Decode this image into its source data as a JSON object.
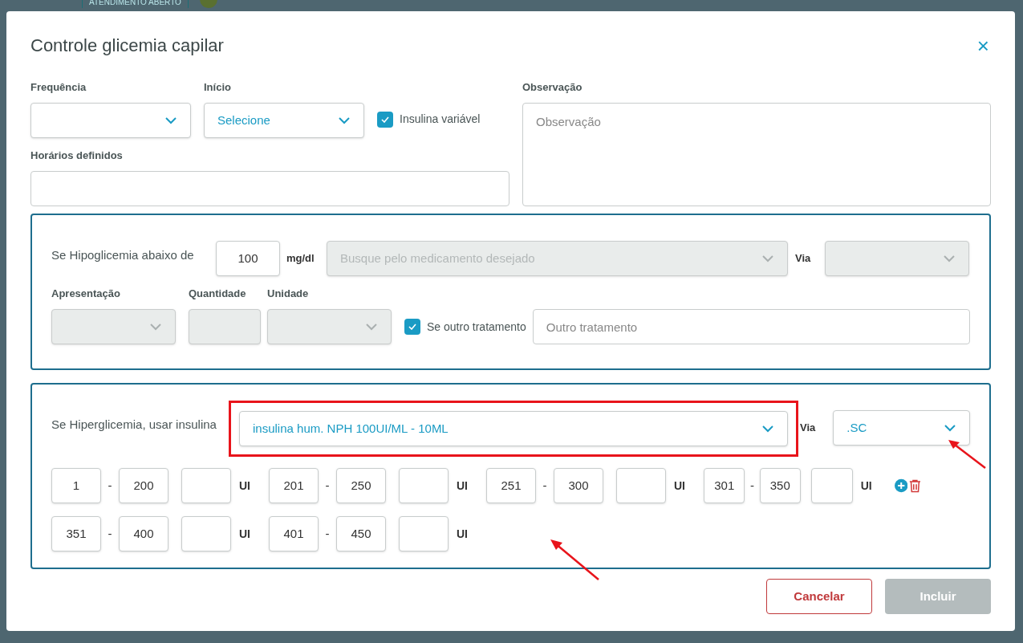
{
  "background": {
    "status_badge": "ATENDIMENTO ABERTO"
  },
  "dialog": {
    "title": "Controle glicemia capilar",
    "close": "×",
    "frequencia": {
      "label": "Frequência"
    },
    "inicio": {
      "label": "Início",
      "value": "Selecione"
    },
    "insulina_variavel": {
      "label": "Insulina variável",
      "checked": true
    },
    "horarios": {
      "label": "Horários definidos"
    },
    "observacao": {
      "label": "Observação",
      "placeholder": "Observação"
    },
    "hipo": {
      "label": "Se Hipoglicemia abaixo de",
      "value": "100",
      "unit": "mg/dl",
      "medicamento_placeholder": "Busque pelo medicamento desejado",
      "via_label": "Via",
      "apresentacao_label": "Apresentação",
      "quantidade_label": "Quantidade",
      "unidade_label": "Unidade",
      "outro": {
        "label": "Se outro tratamento",
        "checked": true
      },
      "outro_placeholder": "Outro tratamento",
      "disabled": true
    },
    "hiper": {
      "label": "Se Hiperglicemia, usar insulina",
      "insulina": "insulina hum. NPH 100UI/ML - 10ML",
      "highlighted": true,
      "via_label": "Via",
      "via": ".SC",
      "ranges": [
        {
          "from": "1",
          "to": "200",
          "unit": "UI"
        },
        {
          "from": "201",
          "to": "250",
          "unit": "UI"
        },
        {
          "from": "251",
          "to": "300",
          "unit": "UI"
        },
        {
          "from": "301",
          "to": "350",
          "unit": "UI"
        },
        {
          "from": "351",
          "to": "400",
          "unit": "UI"
        },
        {
          "from": "401",
          "to": "450",
          "unit": "UI"
        }
      ],
      "separator": "-"
    },
    "buttons": {
      "cancel": "Cancelar",
      "submit": "Incluir",
      "submit_disabled": true
    }
  }
}
